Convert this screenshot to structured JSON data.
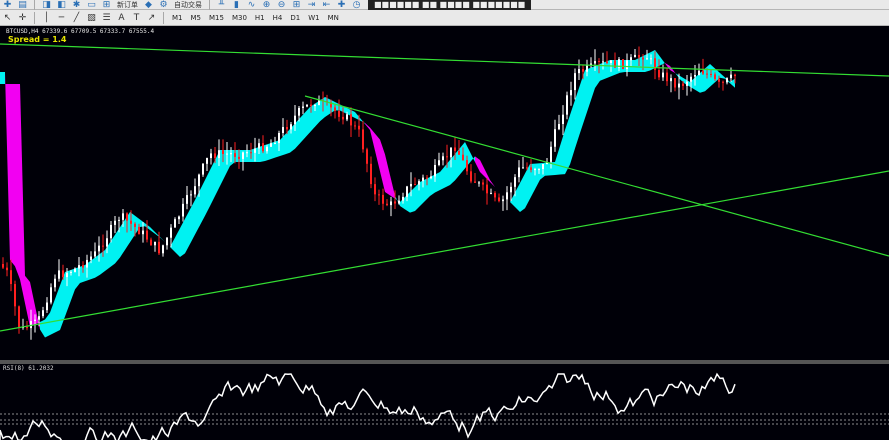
{
  "toolbar_top": {
    "items": [
      "新订单",
      "自动交易"
    ],
    "title": "■■■■■■ ■■ ■■■■ ■■■■■■■"
  },
  "toolbar_periods": [
    "M1",
    "M5",
    "M15",
    "M30",
    "H1",
    "H4",
    "D1",
    "W1",
    "MN"
  ],
  "chart": {
    "symbol_info": "BTCUSD,H4  67339.6 67709.5 67333.7 67555.4",
    "spread_text": "Spread = 1.4",
    "colors": {
      "background": "#000008",
      "bull_candle": "#ffffff",
      "bear_candle": "#ff2020",
      "cloud_up": "#00ffff",
      "cloud_down": "#ff00ff",
      "trend_line": "#33dd33",
      "rsi_line": "#ffffff"
    }
  },
  "chart_data": {
    "type": "line",
    "title": "",
    "xlabel": "",
    "ylabel": "",
    "series": []
  },
  "rsi": {
    "label": "RSI(8) 61.2032"
  }
}
